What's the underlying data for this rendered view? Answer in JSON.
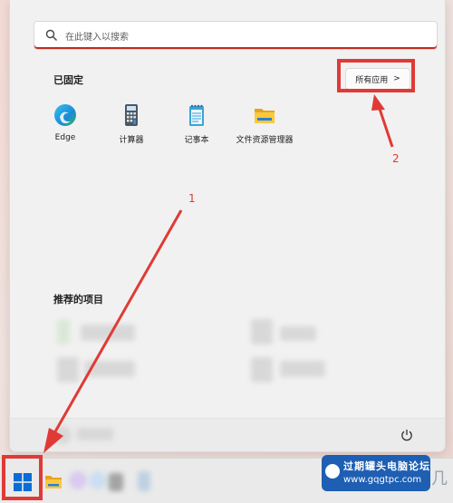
{
  "search": {
    "placeholder": "在此键入以搜索"
  },
  "pinned": {
    "title": "已固定",
    "all_apps_label": "所有应用",
    "all_apps_chevron": ">",
    "apps": [
      {
        "label": "Edge",
        "icon": "edge-icon"
      },
      {
        "label": "计算器",
        "icon": "calculator-icon"
      },
      {
        "label": "记事本",
        "icon": "notepad-icon"
      },
      {
        "label": "文件资源管理器",
        "icon": "file-explorer-icon"
      }
    ]
  },
  "recommended": {
    "title": "推荐的项目"
  },
  "annotations": {
    "one": "1",
    "two": "2"
  },
  "colors": {
    "highlight": "#e03a36",
    "accent": "#c42b1c",
    "windows_blue": "#0a6cd6"
  },
  "watermark": {
    "line1": "过期罐头电脑论坛",
    "line2": "www.gqgtpc.com",
    "trail": "几"
  }
}
